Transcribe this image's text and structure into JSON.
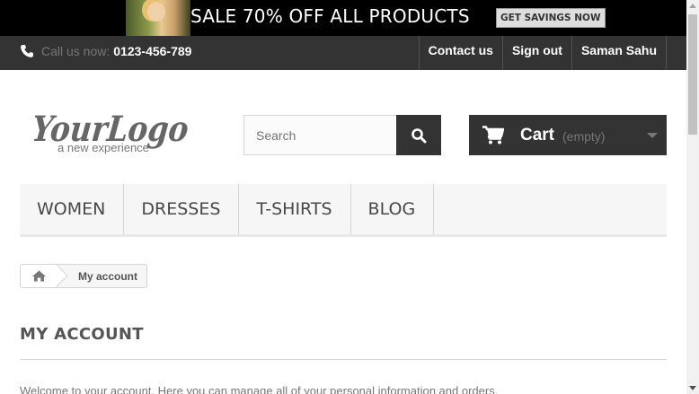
{
  "banner": {
    "text": "SALE 70% OFF ALL PRODUCTS",
    "button_label": "GET SAVINGS NOW"
  },
  "topnav": {
    "call_label": "Call us now:",
    "phone": "0123-456-789",
    "links": [
      "Contact us",
      "Sign out",
      "Saman Sahu"
    ]
  },
  "logo": {
    "main": "YourLogo",
    "tagline": "a new experience"
  },
  "search": {
    "placeholder": "Search",
    "icon": "search-icon"
  },
  "cart": {
    "label": "Cart",
    "status": "(empty)",
    "icon": "cart-icon"
  },
  "menu": {
    "items": [
      "WOMEN",
      "DRESSES",
      "T-SHIRTS",
      "BLOG"
    ]
  },
  "breadcrumb": {
    "home_icon": "home-icon",
    "current": "My account"
  },
  "page": {
    "title": "MY ACCOUNT",
    "welcome": "Welcome to your account. Here you can manage all of your personal information and orders."
  },
  "colors": {
    "dark": "#333333",
    "banner_bg": "#000000",
    "menu_bg": "#f6f6f6"
  }
}
